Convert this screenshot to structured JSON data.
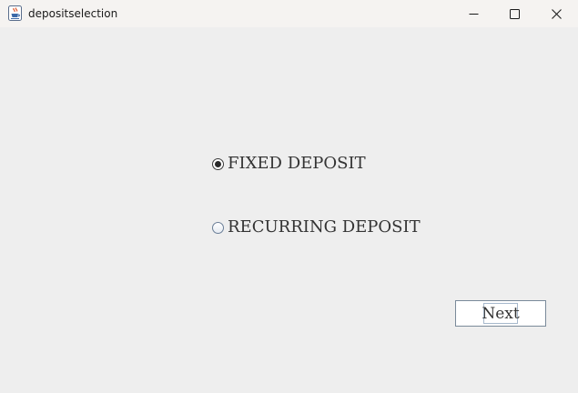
{
  "window": {
    "title": "depositselection",
    "app_icon": "java-cup-icon",
    "controls": [
      "minimize-icon",
      "maximize-icon",
      "close-icon"
    ]
  },
  "options": {
    "fixed": {
      "label": "FIXED DEPOSIT",
      "selected": true
    },
    "recurring": {
      "label": "RECURRING DEPOSIT",
      "selected": false
    }
  },
  "actions": {
    "next_label": "Next"
  },
  "colors": {
    "background": "#eeeeee",
    "titlebar": "#f5f3f1",
    "text": "#333333",
    "button_border": "#7a8a9a"
  }
}
